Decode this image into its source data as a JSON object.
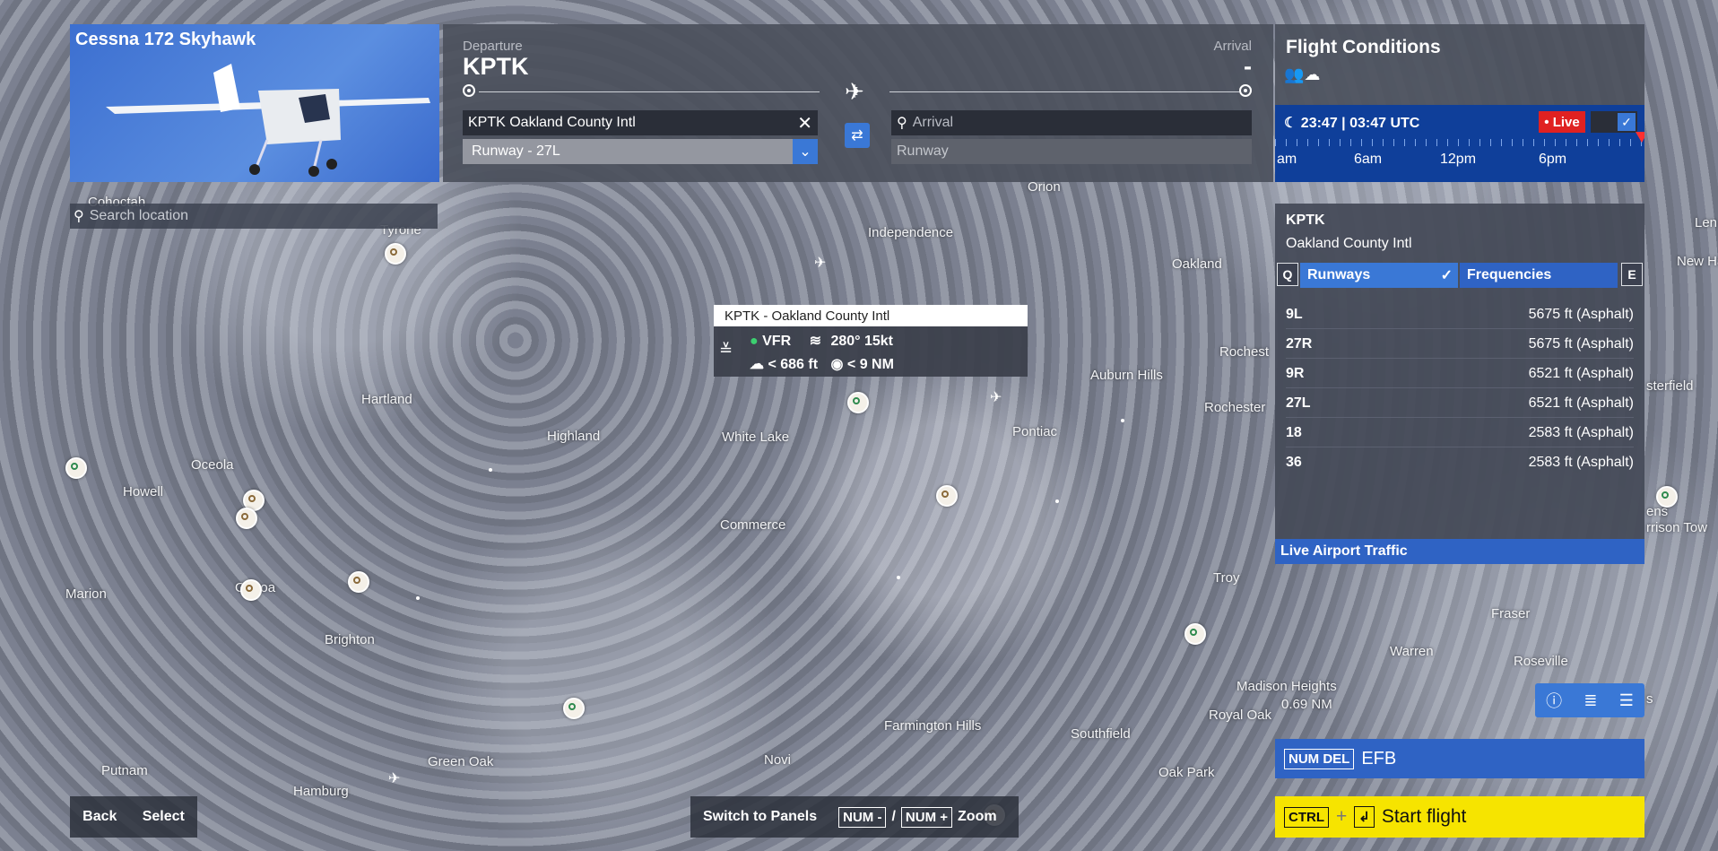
{
  "aircraft": {
    "name": "Cessna 172 Skyhawk"
  },
  "search": {
    "placeholder": "Search location"
  },
  "flight_plan": {
    "departure_label": "Departure",
    "departure_code": "KPTK",
    "arrival_label": "Arrival",
    "arrival_code": "-",
    "departure_airport": "KPTK Oakland County Intl",
    "departure_runway": "Runway - 27L",
    "arrival_placeholder": "Arrival",
    "arrival_runway_placeholder": "Runway"
  },
  "conditions": {
    "title": "Flight Conditions",
    "time": "23:47 | 03:47 UTC",
    "live_label": "• Live",
    "hours": [
      "am",
      "6am",
      "12pm",
      "6pm"
    ]
  },
  "airport_info": {
    "code": "KPTK",
    "name": "Oakland County Intl",
    "key_left": "Q",
    "key_right": "E",
    "tab_runways": "Runways",
    "tab_frequencies": "Frequencies",
    "runways": [
      {
        "id": "9L",
        "length": "5675 ft (Asphalt)"
      },
      {
        "id": "27R",
        "length": "5675 ft (Asphalt)"
      },
      {
        "id": "9R",
        "length": "6521 ft (Asphalt)"
      },
      {
        "id": "27L",
        "length": "6521 ft (Asphalt)"
      },
      {
        "id": "18",
        "length": "2583 ft (Asphalt)"
      },
      {
        "id": "36",
        "length": "2583 ft (Asphalt)"
      }
    ],
    "live_traffic": "Live Airport Traffic"
  },
  "tooltip": {
    "title": "KPTK - Oakland County Intl",
    "flight_rules": "VFR",
    "wind": "280° 15kt",
    "ceiling": "< 686 ft",
    "visibility": "< 9 NM"
  },
  "map": {
    "cities": [
      "Cohoctah",
      "Tyrone",
      "Orion",
      "Independence",
      "Oakland",
      "Hartland",
      "Highland",
      "White Lake",
      "Pontiac",
      "Auburn Hills",
      "Rochest",
      "Rochester",
      "Oceola",
      "Howell",
      "Commerce",
      "Marion",
      "Genoa",
      "Brighton",
      "Troy",
      "Fraser",
      "Warren",
      "Roseville",
      "Madison Heights",
      "Royal Oak",
      "Farmington Hills",
      "Southfield",
      "Novi",
      "Green Oak",
      "Putnam",
      "Hamburg",
      "Oak Park",
      "Len",
      "New Ha",
      "sterfield",
      "ens",
      "rrison Tow",
      "s"
    ],
    "scale": "0.69 NM"
  },
  "bottom": {
    "back": "Back",
    "select": "Select",
    "switch_panels": "Switch to Panels",
    "num_minus": "NUM -",
    "slash": "/",
    "num_plus": "NUM +",
    "zoom": "Zoom",
    "efb_key": "NUM DEL",
    "efb": "EFB",
    "ctrl": "CTRL",
    "plus": "+",
    "enter_icon": "↲",
    "start_flight": "Start flight"
  }
}
